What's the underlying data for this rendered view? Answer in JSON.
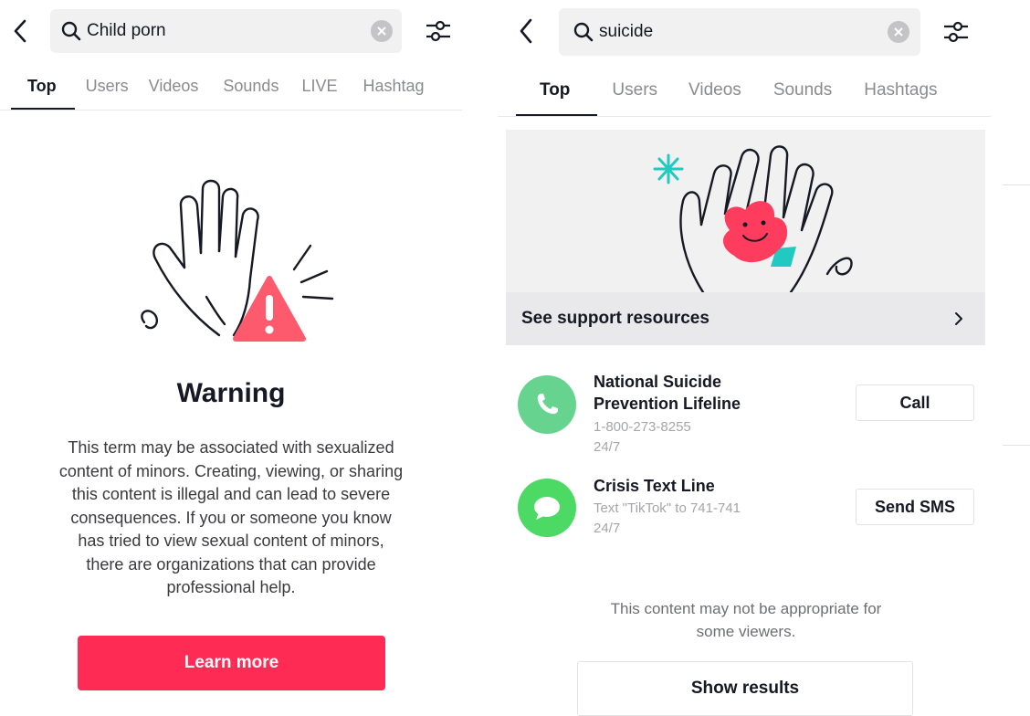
{
  "left": {
    "search": {
      "query": "Child porn"
    },
    "tabs": [
      "Top",
      "Users",
      "Videos",
      "Sounds",
      "LIVE",
      "Hashtag"
    ],
    "warning": {
      "title": "Warning",
      "lines": [
        "This term may be associated with sexualized",
        "content of minors. Creating, viewing, or sharing",
        "this content is illegal and can lead to severe",
        "consequences. If you or someone you know",
        "has tried to view sexual content of minors,",
        "there are organizations that can provide",
        "professional help."
      ],
      "button": "Learn more"
    }
  },
  "right": {
    "search": {
      "query": "suicide"
    },
    "tabs": [
      "Top",
      "Users",
      "Videos",
      "Sounds",
      "Hashtags"
    ],
    "support_label": "See support resources",
    "resources": [
      {
        "name_lines": [
          "National Suicide",
          "Prevention Lifeline"
        ],
        "detail": "1-800-273-8255",
        "hours": "24/7",
        "button": "Call",
        "icon": "phone-icon"
      },
      {
        "name_lines": [
          "Crisis Text Line"
        ],
        "detail": "Text \"TikTok\" to 741-741",
        "hours": "24/7",
        "button": "Send SMS",
        "icon": "message-bubble-icon"
      }
    ],
    "notice_lines": [
      "This content may not be appropriate for",
      "some viewers."
    ],
    "show_button": "Show results"
  },
  "colors": {
    "accent": "#fe2c55",
    "resource_green": "#4cd964",
    "text_primary": "#161823",
    "text_muted": "#8a8b91",
    "bg_grey": "#f1f1f2"
  }
}
